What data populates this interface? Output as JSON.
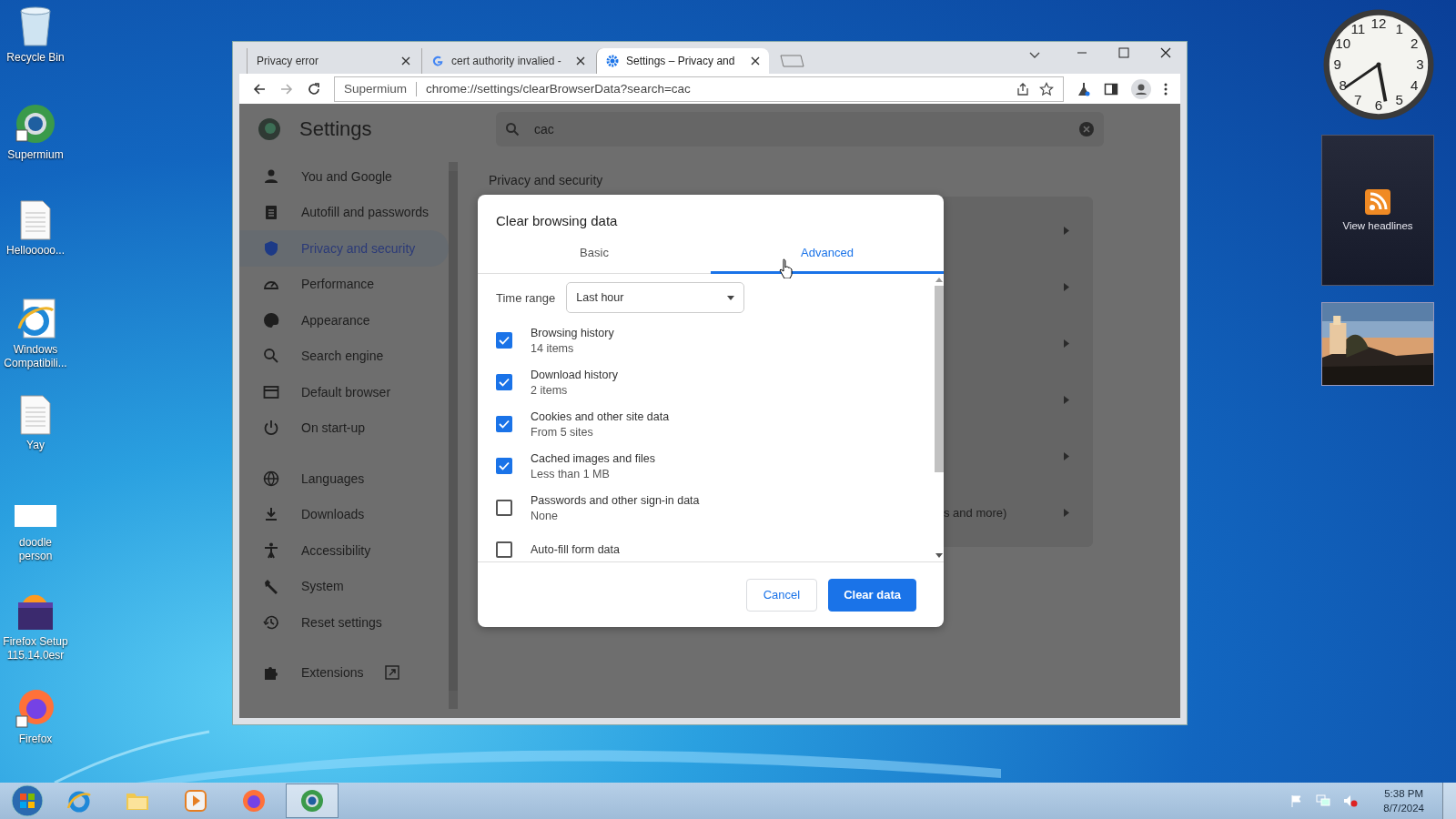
{
  "desktop_icons": [
    {
      "label": "Recycle Bin",
      "kind": "bin"
    },
    {
      "label": "Supermium",
      "kind": "browser"
    },
    {
      "label": "Hellooooo...",
      "kind": "doc"
    },
    {
      "label": "Windows Compatibili...",
      "kind": "ie"
    },
    {
      "label": "Yay",
      "kind": "doc"
    },
    {
      "label": "doodle person",
      "kind": "blank"
    },
    {
      "label": "Firefox Setup 115.14.0esr",
      "kind": "setup"
    },
    {
      "label": "Firefox",
      "kind": "firefox"
    }
  ],
  "browser": {
    "tabs": [
      {
        "title": "Privacy error",
        "kind": "plain",
        "selected": false
      },
      {
        "title": "cert authority invalied -",
        "kind": "search_result",
        "selected": false
      },
      {
        "title": "Settings – Privacy and",
        "kind": "settings",
        "selected": true
      }
    ],
    "omnibox": {
      "site": "Supermium",
      "url": "chrome://settings/clearBrowserData?search=cac"
    }
  },
  "settings": {
    "title": "Settings",
    "search": {
      "value": "cac"
    },
    "sidebar": {
      "groups": [
        [
          {
            "label": "You and Google",
            "kind": "person",
            "selected": false
          },
          {
            "label": "Autofill and passwords",
            "kind": "clipboard",
            "selected": false
          },
          {
            "label": "Privacy and security",
            "kind": "shield",
            "selected": true
          },
          {
            "label": "Performance",
            "kind": "gauge",
            "selected": false
          },
          {
            "label": "Appearance",
            "kind": "palette",
            "selected": false
          },
          {
            "label": "Search engine",
            "kind": "search",
            "selected": false
          },
          {
            "label": "Default browser",
            "kind": "window",
            "selected": false
          },
          {
            "label": "On start-up",
            "kind": "power",
            "selected": false
          }
        ],
        [
          {
            "label": "Languages",
            "kind": "globe",
            "selected": false
          },
          {
            "label": "Downloads",
            "kind": "download",
            "selected": false
          },
          {
            "label": "Accessibility",
            "kind": "accessibility",
            "selected": false
          },
          {
            "label": "System",
            "kind": "wrench",
            "selected": false
          },
          {
            "label": "Reset settings",
            "kind": "history",
            "selected": false
          }
        ],
        [
          {
            "label": "Extensions",
            "kind": "puzzle",
            "selected": false,
            "external": true
          }
        ]
      ]
    },
    "section_title": "Privacy and security",
    "card_rows": [
      {
        "kind": "row"
      },
      {
        "kind": "row"
      },
      {
        "kind": "row"
      },
      {
        "kind": "row"
      },
      {
        "kind": "row"
      },
      {
        "kind": "text",
        "text": "s and more)"
      }
    ]
  },
  "dialog": {
    "title": "Clear browsing data",
    "tabs": [
      {
        "label": "Basic",
        "selected": false
      },
      {
        "label": "Advanced",
        "selected": true
      }
    ],
    "time_range": {
      "label": "Time range",
      "value": "Last hour"
    },
    "options": [
      {
        "label": "Browsing history",
        "detail": "14 items",
        "checked": true
      },
      {
        "label": "Download history",
        "detail": "2 items",
        "checked": true
      },
      {
        "label": "Cookies and other site data",
        "detail": "From 5 sites",
        "checked": true
      },
      {
        "label": "Cached images and files",
        "detail": "Less than 1 MB",
        "checked": true
      },
      {
        "label": "Passwords and other sign-in data",
        "detail": "None",
        "checked": false
      },
      {
        "label": "Auto-fill form data",
        "checked": false
      }
    ],
    "buttons": [
      {
        "label": "Cancel",
        "kind": "secondary"
      },
      {
        "label": "Clear data",
        "kind": "primary"
      }
    ]
  },
  "gadgets": {
    "clock_numerals": [
      "11",
      "12",
      "1",
      "10",
      "2",
      "9",
      "3",
      "8",
      "4",
      "7",
      "6",
      "5"
    ],
    "headlines": "View headlines"
  },
  "taskbar": {
    "items": [
      {
        "kind": "ie",
        "selected": false
      },
      {
        "kind": "folder",
        "selected": false
      },
      {
        "kind": "media",
        "selected": false
      },
      {
        "kind": "firefox",
        "selected": false
      },
      {
        "kind": "browser",
        "selected": true
      }
    ],
    "time": "5:38 PM",
    "date": "8/7/2024"
  }
}
